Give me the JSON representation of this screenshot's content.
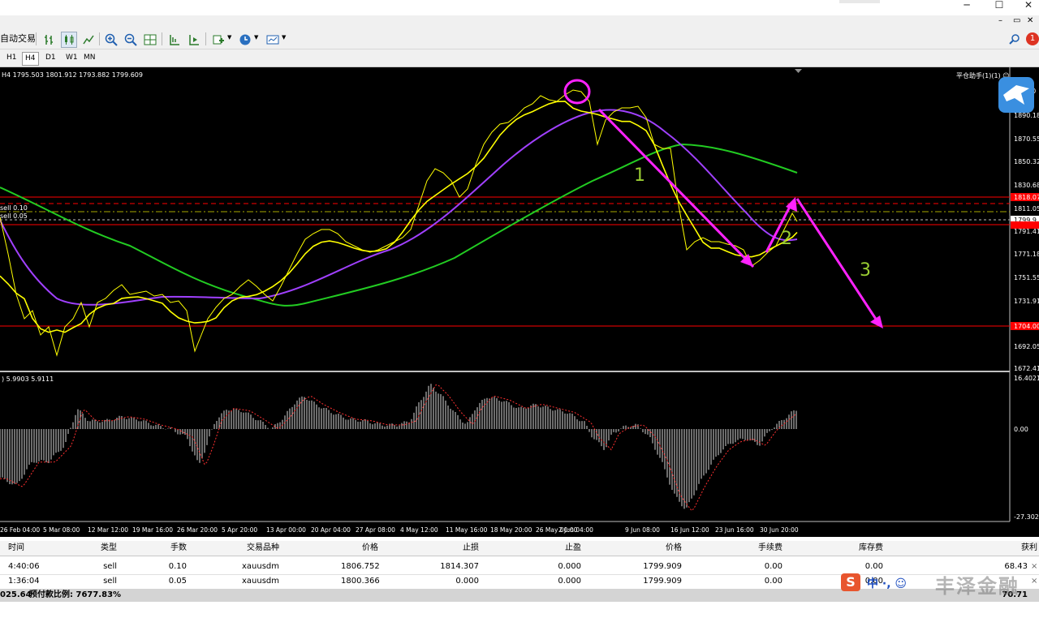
{
  "window": {
    "title_buttons": [
      "─",
      "☐",
      "✕"
    ],
    "mdi_buttons": [
      "–",
      "▭",
      "✕"
    ],
    "notif_badge": "1"
  },
  "toolbar": {
    "autotrade_label": "自动交易"
  },
  "timeframes": [
    "H1",
    "H4",
    "D1",
    "W1",
    "MN"
  ],
  "active_timeframe": "H4",
  "chart": {
    "ohlc_text": "H4  1795.503 1801.912 1793.882 1799.609",
    "ea_label": "平仓助手(1)(1) ☺",
    "order_labels": [
      "sell 0.10",
      "sell 0.05"
    ],
    "price_ticks": [
      "1890.185",
      "1870.550",
      "1850.320",
      "1830.685",
      "1811.050",
      "1791.415",
      "1771.185",
      "1751.550",
      "1731.915",
      "1692.050",
      "1672.415"
    ],
    "top_tick": "20",
    "red_labels": [
      "1818.07",
      "1704.00"
    ],
    "current_price": "1799.9",
    "time_ticks": [
      "26 Feb 04:00",
      "5 Mar 08:00",
      "12 Mar 12:00",
      "19 Mar 16:00",
      "26 Mar 20:00",
      "5 Apr 20:00",
      "13 Apr 00:00",
      "20 Apr 04:00",
      "27 Apr 08:00",
      "4 May 12:00",
      "11 May 16:00",
      "18 May 20:00",
      "26 May 00:00",
      "2 Jun 04:00",
      "9 Jun 08:00",
      "16 Jun 12:00",
      "23 Jun 16:00",
      "30 Jun 20:00"
    ],
    "annotations": [
      "1",
      "2",
      "3"
    ],
    "colors": {
      "price": "#ffff00",
      "ma_purple": "#a040ff",
      "ma_green": "#22cc22",
      "arrow": "#ff22ff",
      "annotation": "#9acd32",
      "red_level": "#ff0000"
    }
  },
  "indicator": {
    "label": ") 5.9903 5.9111",
    "ticks": [
      "16.4021",
      "0.00",
      "-27.3024"
    ]
  },
  "terminal": {
    "headers": [
      "时间",
      "类型",
      "手数",
      "交易品种",
      "价格",
      "止损",
      "止盈",
      "价格",
      "手续费",
      "库存费",
      "获利"
    ],
    "rows": [
      [
        "4:40:06",
        "sell",
        "0.10",
        "xauusdm",
        "1806.752",
        "1814.307",
        "0.000",
        "1799.909",
        "0.00",
        "0.00",
        "68.43"
      ],
      [
        "1:36:04",
        "sell",
        "0.05",
        "xauusdm",
        "1800.366",
        "0.000",
        "0.000",
        "1799.909",
        "0.00",
        "0.00",
        ""
      ]
    ],
    "balance_prefix": "025.64",
    "margin_level_label": "预付款比例: 7677.83%",
    "total_profit": "70.71",
    "close_icon": "×"
  },
  "watermark": {
    "ime_chars": "中 ·, ☺",
    "brand": "丰泽金融"
  }
}
